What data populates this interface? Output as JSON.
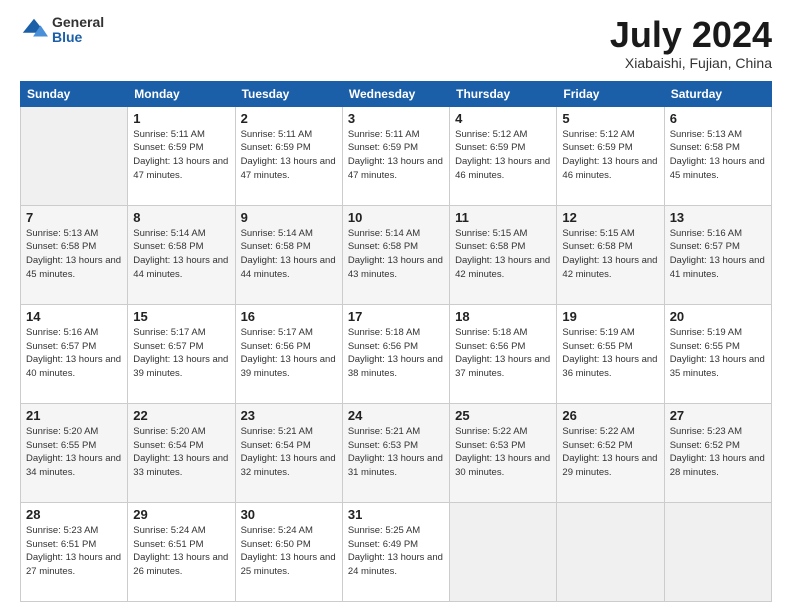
{
  "logo": {
    "general": "General",
    "blue": "Blue"
  },
  "header": {
    "title": "July 2024",
    "subtitle": "Xiabaishi, Fujian, China"
  },
  "weekdays": [
    "Sunday",
    "Monday",
    "Tuesday",
    "Wednesday",
    "Thursday",
    "Friday",
    "Saturday"
  ],
  "weeks": [
    [
      {
        "day": "",
        "info": ""
      },
      {
        "day": "1",
        "info": "Sunrise: 5:11 AM\nSunset: 6:59 PM\nDaylight: 13 hours\nand 47 minutes."
      },
      {
        "day": "2",
        "info": "Sunrise: 5:11 AM\nSunset: 6:59 PM\nDaylight: 13 hours\nand 47 minutes."
      },
      {
        "day": "3",
        "info": "Sunrise: 5:11 AM\nSunset: 6:59 PM\nDaylight: 13 hours\nand 47 minutes."
      },
      {
        "day": "4",
        "info": "Sunrise: 5:12 AM\nSunset: 6:59 PM\nDaylight: 13 hours\nand 46 minutes."
      },
      {
        "day": "5",
        "info": "Sunrise: 5:12 AM\nSunset: 6:59 PM\nDaylight: 13 hours\nand 46 minutes."
      },
      {
        "day": "6",
        "info": "Sunrise: 5:13 AM\nSunset: 6:58 PM\nDaylight: 13 hours\nand 45 minutes."
      }
    ],
    [
      {
        "day": "7",
        "info": "Sunrise: 5:13 AM\nSunset: 6:58 PM\nDaylight: 13 hours\nand 45 minutes."
      },
      {
        "day": "8",
        "info": "Sunrise: 5:14 AM\nSunset: 6:58 PM\nDaylight: 13 hours\nand 44 minutes."
      },
      {
        "day": "9",
        "info": "Sunrise: 5:14 AM\nSunset: 6:58 PM\nDaylight: 13 hours\nand 44 minutes."
      },
      {
        "day": "10",
        "info": "Sunrise: 5:14 AM\nSunset: 6:58 PM\nDaylight: 13 hours\nand 43 minutes."
      },
      {
        "day": "11",
        "info": "Sunrise: 5:15 AM\nSunset: 6:58 PM\nDaylight: 13 hours\nand 42 minutes."
      },
      {
        "day": "12",
        "info": "Sunrise: 5:15 AM\nSunset: 6:58 PM\nDaylight: 13 hours\nand 42 minutes."
      },
      {
        "day": "13",
        "info": "Sunrise: 5:16 AM\nSunset: 6:57 PM\nDaylight: 13 hours\nand 41 minutes."
      }
    ],
    [
      {
        "day": "14",
        "info": "Sunrise: 5:16 AM\nSunset: 6:57 PM\nDaylight: 13 hours\nand 40 minutes."
      },
      {
        "day": "15",
        "info": "Sunrise: 5:17 AM\nSunset: 6:57 PM\nDaylight: 13 hours\nand 39 minutes."
      },
      {
        "day": "16",
        "info": "Sunrise: 5:17 AM\nSunset: 6:56 PM\nDaylight: 13 hours\nand 39 minutes."
      },
      {
        "day": "17",
        "info": "Sunrise: 5:18 AM\nSunset: 6:56 PM\nDaylight: 13 hours\nand 38 minutes."
      },
      {
        "day": "18",
        "info": "Sunrise: 5:18 AM\nSunset: 6:56 PM\nDaylight: 13 hours\nand 37 minutes."
      },
      {
        "day": "19",
        "info": "Sunrise: 5:19 AM\nSunset: 6:55 PM\nDaylight: 13 hours\nand 36 minutes."
      },
      {
        "day": "20",
        "info": "Sunrise: 5:19 AM\nSunset: 6:55 PM\nDaylight: 13 hours\nand 35 minutes."
      }
    ],
    [
      {
        "day": "21",
        "info": "Sunrise: 5:20 AM\nSunset: 6:55 PM\nDaylight: 13 hours\nand 34 minutes."
      },
      {
        "day": "22",
        "info": "Sunrise: 5:20 AM\nSunset: 6:54 PM\nDaylight: 13 hours\nand 33 minutes."
      },
      {
        "day": "23",
        "info": "Sunrise: 5:21 AM\nSunset: 6:54 PM\nDaylight: 13 hours\nand 32 minutes."
      },
      {
        "day": "24",
        "info": "Sunrise: 5:21 AM\nSunset: 6:53 PM\nDaylight: 13 hours\nand 31 minutes."
      },
      {
        "day": "25",
        "info": "Sunrise: 5:22 AM\nSunset: 6:53 PM\nDaylight: 13 hours\nand 30 minutes."
      },
      {
        "day": "26",
        "info": "Sunrise: 5:22 AM\nSunset: 6:52 PM\nDaylight: 13 hours\nand 29 minutes."
      },
      {
        "day": "27",
        "info": "Sunrise: 5:23 AM\nSunset: 6:52 PM\nDaylight: 13 hours\nand 28 minutes."
      }
    ],
    [
      {
        "day": "28",
        "info": "Sunrise: 5:23 AM\nSunset: 6:51 PM\nDaylight: 13 hours\nand 27 minutes."
      },
      {
        "day": "29",
        "info": "Sunrise: 5:24 AM\nSunset: 6:51 PM\nDaylight: 13 hours\nand 26 minutes."
      },
      {
        "day": "30",
        "info": "Sunrise: 5:24 AM\nSunset: 6:50 PM\nDaylight: 13 hours\nand 25 minutes."
      },
      {
        "day": "31",
        "info": "Sunrise: 5:25 AM\nSunset: 6:49 PM\nDaylight: 13 hours\nand 24 minutes."
      },
      {
        "day": "",
        "info": ""
      },
      {
        "day": "",
        "info": ""
      },
      {
        "day": "",
        "info": ""
      }
    ]
  ]
}
